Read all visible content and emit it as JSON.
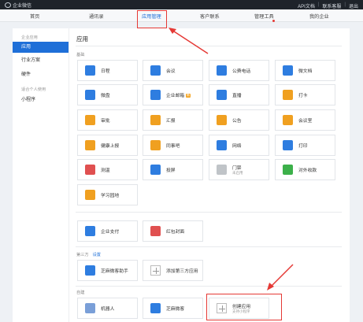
{
  "topbar": {
    "logo_text": "企业微信",
    "links": [
      "API文档",
      "联系客服",
      "退出"
    ]
  },
  "nav": {
    "tabs": [
      {
        "label": "首页",
        "left": 0
      },
      {
        "label": "通讯录"
      },
      {
        "label": "应用管理",
        "active": true
      },
      {
        "label": "客户联系"
      },
      {
        "label": "管理工具",
        "dot": true
      },
      {
        "label": "我的企业"
      }
    ]
  },
  "sidebar": {
    "group1": "企业应用",
    "items1": [
      "应用",
      "行业方案",
      "硬件"
    ],
    "group2": "适合个人使用",
    "items2": [
      "小程序"
    ]
  },
  "main": {
    "title": "应用",
    "sections": {
      "basic": "基础",
      "third": "第三方",
      "third_link": "设置",
      "custom": "自建"
    },
    "apps": [
      {
        "label": "日程",
        "icon": "calendar-icon",
        "color": "#2e7de0"
      },
      {
        "label": "会议",
        "icon": "cloud-icon",
        "color": "#2e7de0"
      },
      {
        "label": "公费电话",
        "icon": "phone-icon",
        "color": "#2e7de0"
      },
      {
        "label": "微文档",
        "icon": "doc-icon",
        "color": "#2e7de0"
      },
      {
        "label": "微盘",
        "icon": "disk-icon",
        "color": "#2e7de0"
      },
      {
        "label": "企业邮箱",
        "icon": "mail-icon",
        "color": "#2e7de0",
        "badge": "新"
      },
      {
        "label": "直播",
        "icon": "live-icon",
        "color": "#2e7de0"
      },
      {
        "label": "打卡",
        "icon": "location-icon",
        "color": "#f0a020"
      },
      {
        "label": "审批",
        "icon": "stamp-icon",
        "color": "#f0a020"
      },
      {
        "label": "汇报",
        "icon": "report-icon",
        "color": "#f0a020"
      },
      {
        "label": "公告",
        "icon": "announce-icon",
        "color": "#f0a020"
      },
      {
        "label": "会议室",
        "icon": "meeting-room-icon",
        "color": "#f0a020"
      },
      {
        "label": "健康上报",
        "icon": "health-icon",
        "color": "#f0a020"
      },
      {
        "label": "同事吧",
        "icon": "colleague-icon",
        "color": "#f0a020"
      },
      {
        "label": "网络",
        "icon": "network-icon",
        "color": "#2e7de0"
      },
      {
        "label": "打印",
        "icon": "print-icon",
        "color": "#2e7de0"
      },
      {
        "label": "测温",
        "icon": "thermometer-icon",
        "color": "#e05050"
      },
      {
        "label": "投屏",
        "icon": "screen-icon",
        "color": "#2e7de0"
      },
      {
        "label": "门禁",
        "sub": "未启用",
        "icon": "door-icon",
        "color": "#c0c4c8"
      },
      {
        "label": "对外收款",
        "icon": "payment-icon",
        "color": "#3cb04a"
      },
      {
        "label": "学习园地",
        "icon": "learning-icon",
        "color": "#f0a020"
      }
    ],
    "apps2": [
      {
        "label": "企业支付",
        "icon": "pay-icon",
        "color": "#2e7de0"
      },
      {
        "label": "红包封面",
        "icon": "redpacket-icon",
        "color": "#e05050"
      }
    ],
    "third_apps": [
      {
        "label": "芝麻微客助手",
        "icon": "zhima-icon",
        "color": "#2e7de0"
      },
      {
        "label": "添加第三方应用",
        "icon": "plus-icon"
      }
    ],
    "custom_apps": [
      {
        "label": "机器人",
        "icon": "robot-icon",
        "color": "#7a9fd8"
      },
      {
        "label": "芝麻微客",
        "icon": "zhima-icon",
        "color": "#2e7de0"
      },
      {
        "label": "创建应用",
        "sub": "支持小程序",
        "icon": "plus-icon"
      }
    ]
  }
}
